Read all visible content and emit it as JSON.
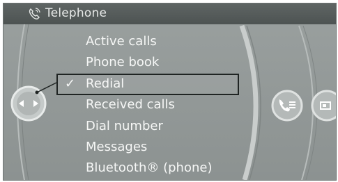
{
  "window": {
    "title": "Telephone",
    "title_icon": "telephone-icon"
  },
  "menu": {
    "items": [
      {
        "label": "Active calls",
        "selected": false
      },
      {
        "label": "Phone book",
        "selected": false
      },
      {
        "label": "Redial",
        "selected": true
      },
      {
        "label": "Received calls",
        "selected": false
      },
      {
        "label": "Dial number",
        "selected": false
      },
      {
        "label": "Messages",
        "selected": false
      },
      {
        "label": "Bluetooth® (phone)",
        "selected": false
      }
    ],
    "check_glyph": "✓"
  },
  "controls": {
    "left_knob_icon": "arrow-left-right-icon",
    "phone_knob_icon": "phone-options-icon",
    "media_knob_icon": "media-icon"
  },
  "colors": {
    "panel": "#939998",
    "title_bar": "#565c5b",
    "text": "#f6f7f6",
    "selection_border": "#1f2423"
  }
}
